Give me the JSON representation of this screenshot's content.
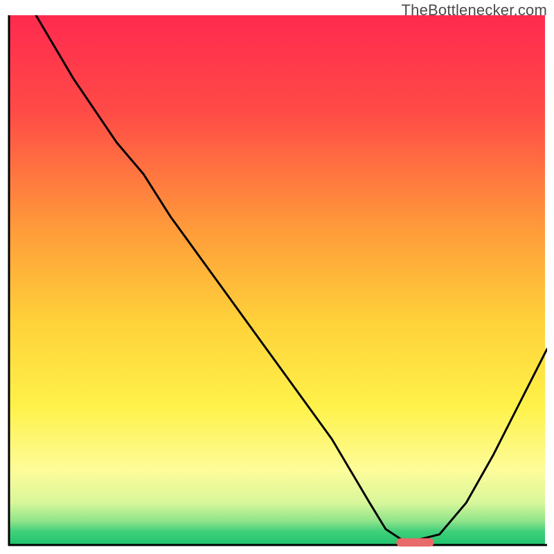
{
  "watermark": "TheBottlenecker.com",
  "chart_data": {
    "type": "line",
    "title": "",
    "xlabel": "",
    "ylabel": "",
    "xlim": [
      0,
      100
    ],
    "ylim": [
      0,
      100
    ],
    "grid": false,
    "legend_position": "none",
    "series": [
      {
        "name": "bottleneck-curve",
        "color": "#000000",
        "x": [
          5,
          12,
          20,
          25,
          30,
          40,
          50,
          60,
          67,
          70,
          73,
          76,
          80,
          85,
          90,
          95,
          100
        ],
        "y": [
          100,
          88,
          76,
          70,
          62,
          48,
          34,
          20,
          8,
          3,
          1,
          1,
          2,
          8,
          17,
          27,
          37
        ]
      }
    ],
    "annotations": [
      {
        "name": "optimal-marker",
        "type": "bar-segment",
        "x_start": 72,
        "x_end": 79,
        "y": 0.5,
        "color": "#e86a6a"
      }
    ],
    "background_gradient": {
      "stops": [
        {
          "offset": 0.0,
          "color": "#ff2a4f"
        },
        {
          "offset": 0.18,
          "color": "#ff4a47"
        },
        {
          "offset": 0.4,
          "color": "#ff9a3a"
        },
        {
          "offset": 0.58,
          "color": "#ffd23a"
        },
        {
          "offset": 0.74,
          "color": "#fff24a"
        },
        {
          "offset": 0.86,
          "color": "#fdfc9a"
        },
        {
          "offset": 0.92,
          "color": "#d8f79a"
        },
        {
          "offset": 0.955,
          "color": "#8fe48a"
        },
        {
          "offset": 0.975,
          "color": "#3fcf7a"
        },
        {
          "offset": 1.0,
          "color": "#1fc46e"
        }
      ]
    },
    "axes_color": "#000000"
  }
}
